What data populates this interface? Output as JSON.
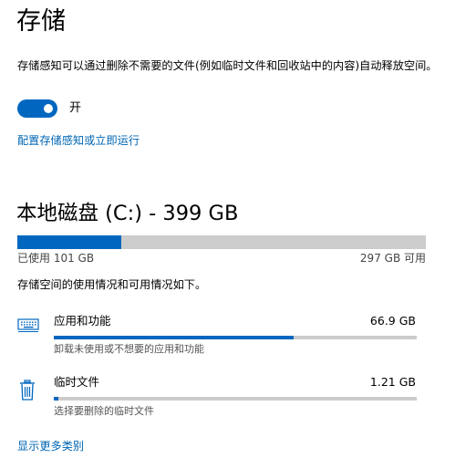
{
  "header": {
    "title": "存储"
  },
  "storage_sense": {
    "description": "存储感知可以通过删除不需要的文件(例如临时文件和回收站中的内容)自动释放空间。",
    "toggle_state_label": "开",
    "toggle_on": true,
    "configure_link": "配置存储感知或立即运行"
  },
  "drive": {
    "title": "本地磁盘 (C:) - 399 GB",
    "used_label": "已使用 101 GB",
    "free_label": "297 GB 可用",
    "used_fraction": 0.254
  },
  "usage_summary": "存储空间的使用情况和可用情况如下。",
  "categories": [
    {
      "title": "应用和功能",
      "size": "66.9 GB",
      "subtitle": "卸载未使用或不想要的应用和功能",
      "icon": "keyboard-icon",
      "fraction": 0.66
    },
    {
      "title": "临时文件",
      "size": "1.21 GB",
      "subtitle": "选择要删除的临时文件",
      "icon": "trash-icon",
      "fraction": 0.012
    }
  ],
  "more_link": "显示更多类别",
  "colors": {
    "accent": "#0067c0",
    "link": "#0066b4",
    "track": "#cccccc"
  }
}
